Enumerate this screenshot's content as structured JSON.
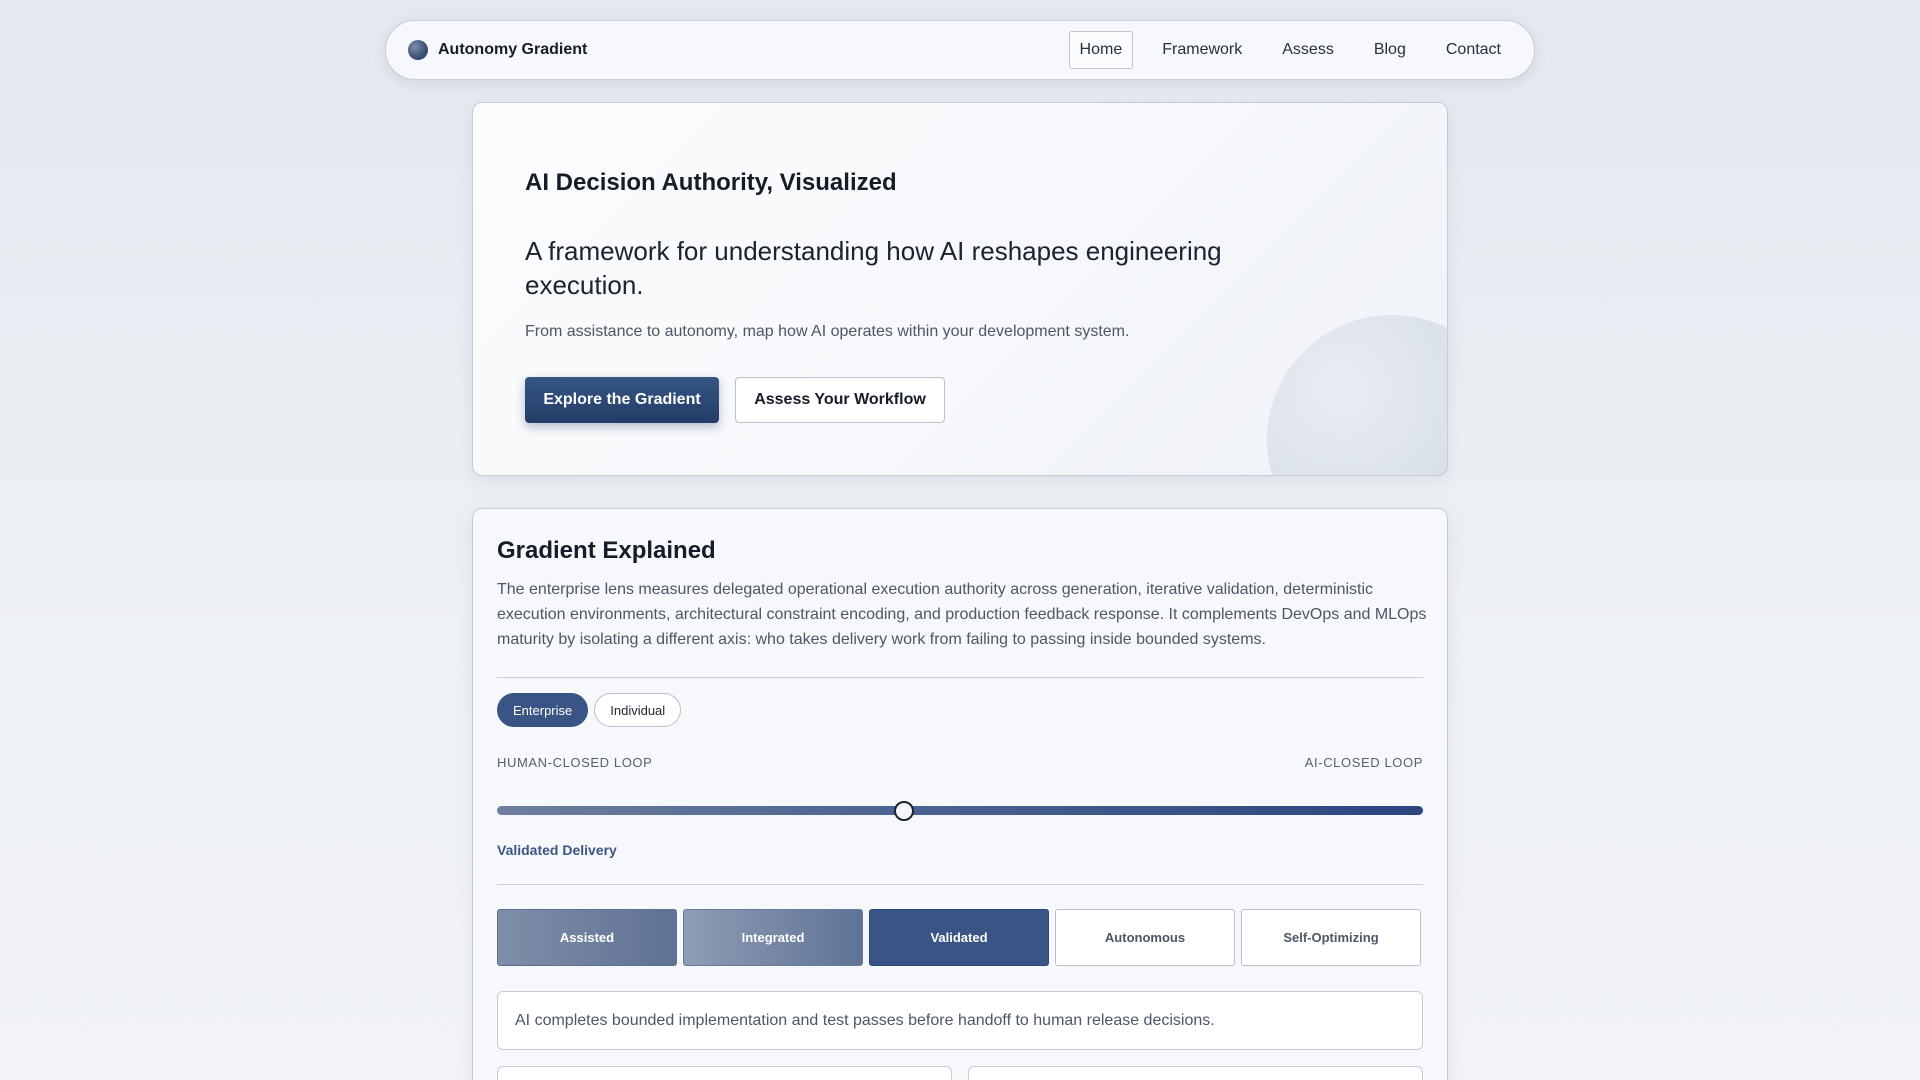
{
  "nav": {
    "brand": "Autonomy Gradient",
    "links": [
      "Home",
      "Framework",
      "Assess",
      "Blog",
      "Contact"
    ],
    "active": "Home"
  },
  "hero": {
    "title": "AI Decision Authority, Visualized",
    "subtitle": "A framework for understanding how AI reshapes engineering execution.",
    "description": "From assistance to autonomy, map how AI operates within your development system.",
    "primary_button": "Explore the Gradient",
    "secondary_button": "Assess Your Workflow"
  },
  "gradient": {
    "title": "Gradient Explained",
    "description": "The enterprise lens measures delegated operational execution authority across generation, iterative validation, deterministic execution environments, architectural constraint encoding, and production feedback response. It complements DevOps and MLOps maturity by isolating a different axis: who takes delivery work from failing to passing inside bounded systems.",
    "lenses": [
      "Enterprise",
      "Individual"
    ],
    "active_lens": "Enterprise",
    "axis_left": "HUMAN-CLOSED LOOP",
    "axis_right": "AI-CLOSED LOOP",
    "slider_value_fraction": 0.44,
    "current_stage": "Validated Delivery",
    "stages": [
      "Assisted",
      "Integrated",
      "Validated",
      "Autonomous",
      "Self-Optimizing"
    ],
    "active_stage": "Validated",
    "stage_description": "AI completes bounded implementation and test passes before handoff to human release decisions."
  },
  "colors": {
    "accent": "#3a5585",
    "primary_button": "#2b4673"
  }
}
